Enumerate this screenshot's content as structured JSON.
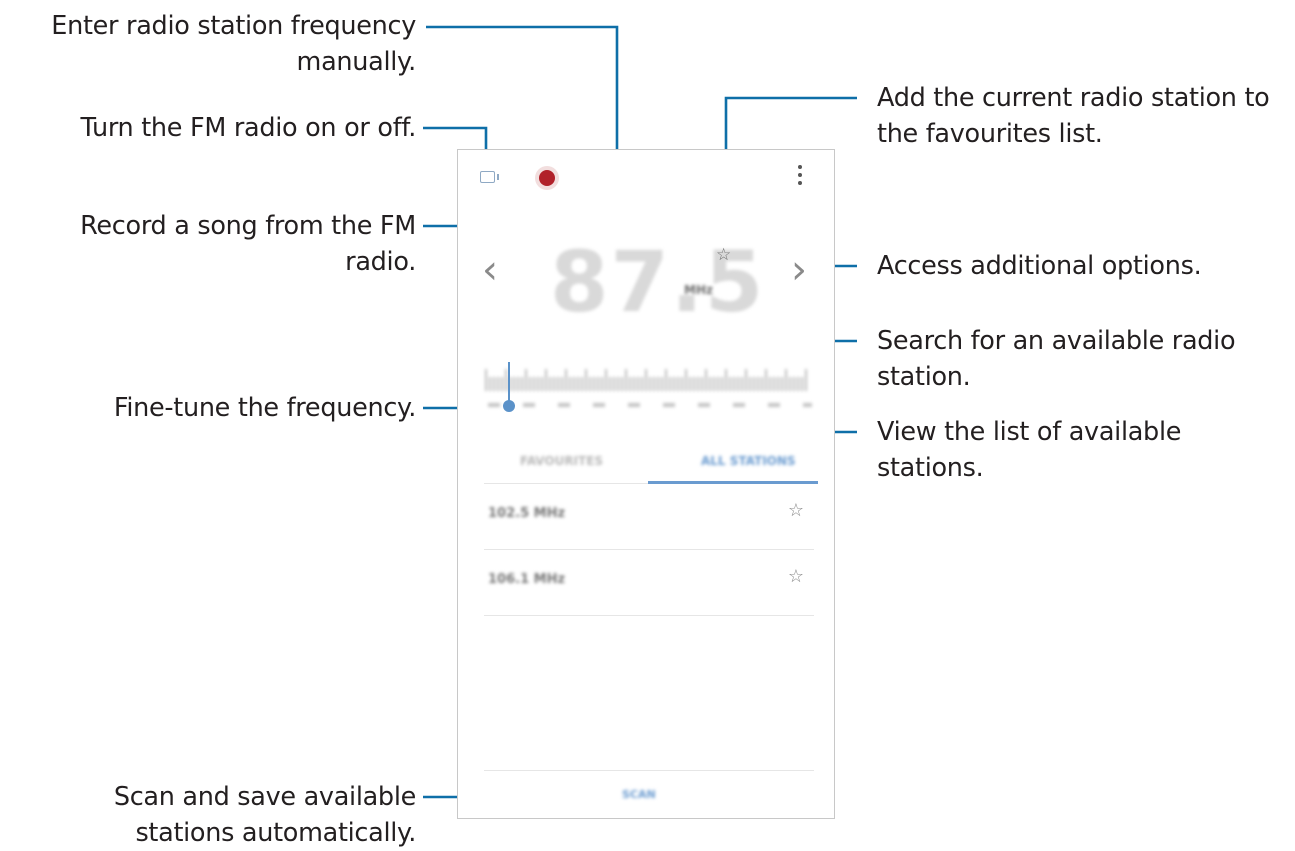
{
  "callouts": {
    "enter_frequency": "Enter radio station frequency manually.",
    "power": "Turn the FM radio on or off.",
    "record": "Record a song from the FM radio.",
    "fine_tune": "Fine-tune the frequency.",
    "scan": "Scan and save available stations automatically.",
    "favourite": "Add the current radio station to the favourites list.",
    "more_options": "Access additional options.",
    "search": "Search for an available radio station.",
    "view_list": "View the list of available stations."
  },
  "radio": {
    "frequency": "87.5",
    "unit": "MHz",
    "tabs": {
      "favourites": "FAVOURITES",
      "all_stations": "ALL STATIONS"
    },
    "stations": [
      {
        "name": "102.5 MHz"
      },
      {
        "name": "106.1 MHz"
      }
    ],
    "scan_label": "SCAN"
  },
  "icons": {
    "power": "radio-power-icon",
    "record": "record-icon",
    "more": "more-options-icon",
    "favourite": "star-icon",
    "prev": "chevron-left-icon",
    "next": "chevron-right-icon"
  },
  "colors": {
    "accent": "#6a9bd0",
    "callout_line": "#0e6fa8",
    "record": "#b1212a"
  }
}
